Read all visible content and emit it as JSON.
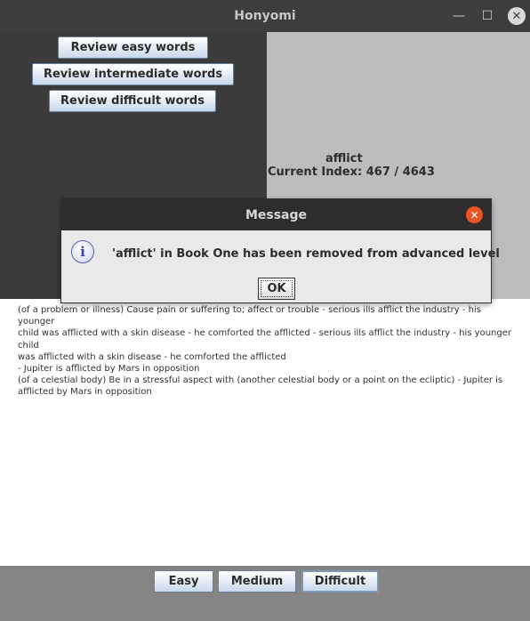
{
  "window": {
    "title": "Honyomi",
    "minimize_glyph": "—",
    "maximize_glyph": "☐",
    "close_glyph": "✕"
  },
  "review_buttons": {
    "easy": "Review easy words",
    "intermediate": "Review intermediate words",
    "difficult": "Review difficult words"
  },
  "word_panel": {
    "word": "afflict",
    "index_text": "Current Index: 467 / 4643"
  },
  "definition_lines": [
    "(of a problem or illness) Cause pain or suffering to; affect or trouble - serious ills afflict the industry - his younger",
    "child was afflicted with a skin disease - he comforted the afflicted - serious ills afflict the industry - his younger child",
    "was afflicted with a skin disease - he comforted the afflicted",
    "- Jupiter is afflicted by Mars in opposition",
    "(of a celestial body) Be in a stressful aspect with (another celestial body or a point on the ecliptic) - Jupiter is",
    "afflicted by Mars in opposition"
  ],
  "level_buttons": {
    "easy": "Easy",
    "medium": "Medium",
    "difficult": "Difficult"
  },
  "dialog": {
    "title": "Message",
    "message": "'afflict' in Book One has been removed from advanced level",
    "ok_label": "OK",
    "info_glyph": "i",
    "close_glyph": "✕"
  }
}
